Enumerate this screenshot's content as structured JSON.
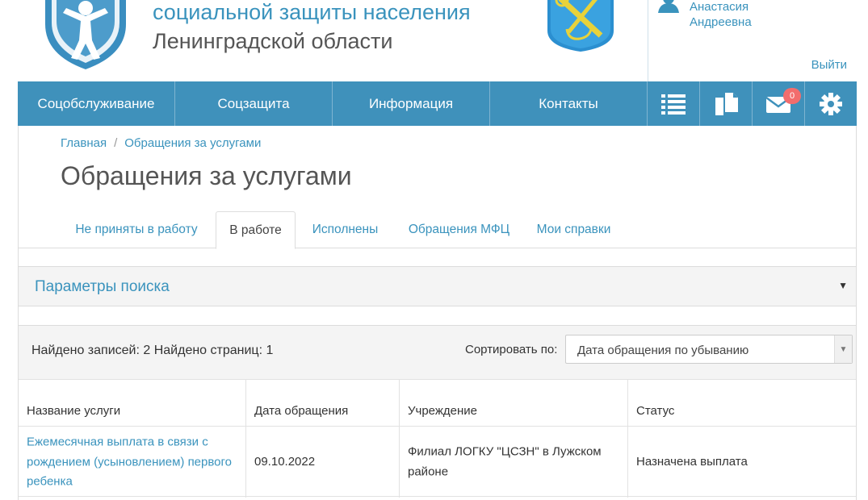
{
  "header": {
    "org_line1": "социальной защиты населения",
    "org_line2": "Ленинградской области",
    "user_first": "Анастасия",
    "user_middle": "Андреевна",
    "logout_label": "Выйти"
  },
  "nav": {
    "items": [
      "Соцобслуживание",
      "Соцзащита",
      "Информация",
      "Контакты"
    ],
    "icons": [
      "list-icon",
      "documents-icon",
      "mail-icon",
      "gear-icon"
    ],
    "mail_badge": "0"
  },
  "breadcrumb": {
    "home": "Главная",
    "separator": "/",
    "current": "Обращения за услугами"
  },
  "page_title": "Обращения за услугами",
  "tabs": [
    {
      "label": "Не приняты в работу",
      "active": false
    },
    {
      "label": "В работе",
      "active": true
    },
    {
      "label": "Исполнены",
      "active": false
    },
    {
      "label": "Обращения МФЦ",
      "active": false
    },
    {
      "label": "Мои справки",
      "active": false
    }
  ],
  "search_panel": {
    "title": "Параметры поиска",
    "caret": "▼"
  },
  "results": {
    "found_text": "Найдено записей: 2 Найдено страниц: 1",
    "sort_label": "Сортировать по:",
    "sort_value": "Дата обращения по убыванию",
    "sort_caret": "▼",
    "columns": [
      "Название услуги",
      "Дата обращения",
      "Учреждение",
      "Статус"
    ],
    "rows": [
      {
        "service": "Ежемесячная выплата в связи с рождением (усыновлением) первого ребенка",
        "date": "09.10.2022",
        "institution": "Филиал ЛОГКУ \"ЦСЗН\" в Лужском районе",
        "status": "Назначена выплата"
      }
    ]
  },
  "colors": {
    "accent": "#3a93bd",
    "nav_bg": "#3f91bb",
    "badge": "#f26d6d"
  }
}
